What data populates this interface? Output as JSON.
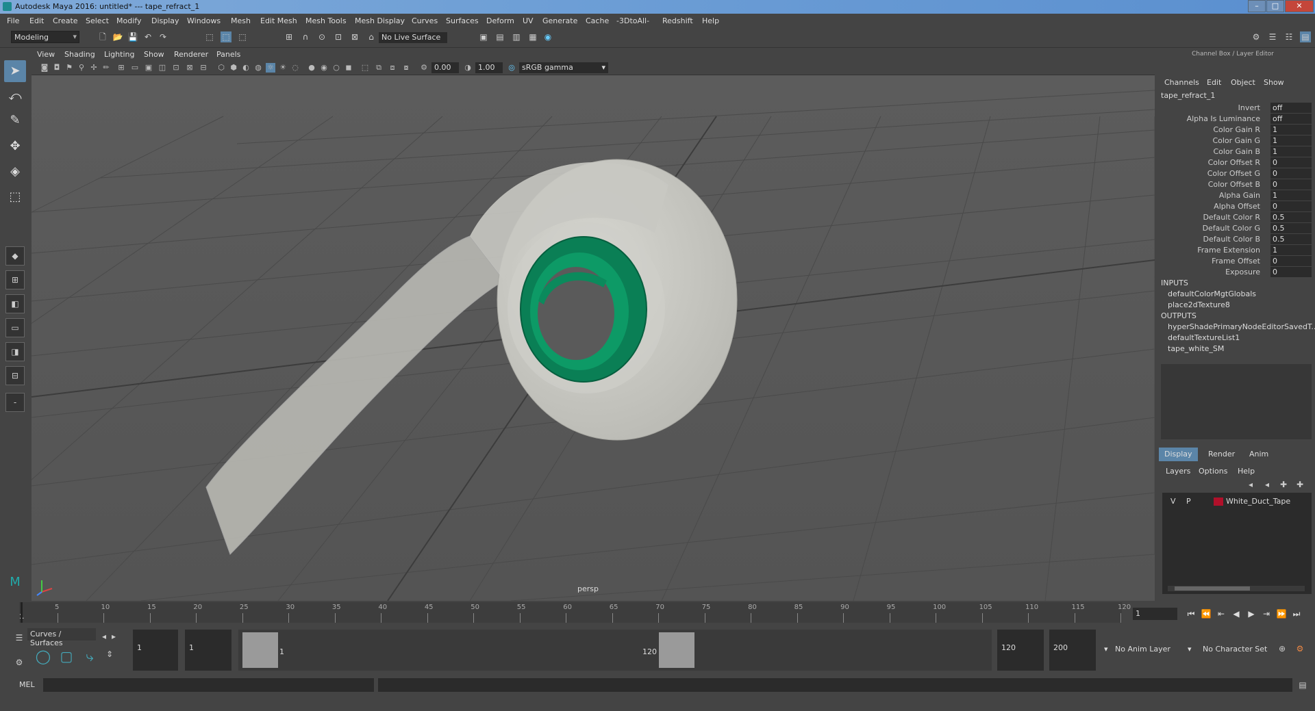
{
  "window": {
    "title": "Autodesk Maya 2016: untitled*   ---   tape_refract_1"
  },
  "menu": [
    "File",
    "Edit",
    "Create",
    "Select",
    "Modify",
    "Display",
    "Windows",
    "Mesh",
    "Edit Mesh",
    "Mesh Tools",
    "Mesh Display",
    "Curves",
    "Surfaces",
    "Deform",
    "UV",
    "Generate",
    "Cache",
    "-3DtoAll-",
    "Redshift",
    "Help"
  ],
  "shelf": {
    "mode": "Modeling",
    "live_surface": "No Live Surface"
  },
  "viewport": {
    "menu": [
      "View",
      "Shading",
      "Lighting",
      "Show",
      "Renderer",
      "Panels"
    ],
    "exposure": "0.00",
    "gamma": "1.00",
    "color_space": "sRGB gamma",
    "camera": "persp"
  },
  "channel_box": {
    "header": "Channel Box / Layer Editor",
    "tabs": [
      "Channels",
      "Edit",
      "Object",
      "Show"
    ],
    "node": "tape_refract_1",
    "attributes": [
      {
        "label": "Invert",
        "value": "off"
      },
      {
        "label": "Alpha Is Luminance",
        "value": "off"
      },
      {
        "label": "Color Gain R",
        "value": "1"
      },
      {
        "label": "Color Gain G",
        "value": "1"
      },
      {
        "label": "Color Gain B",
        "value": "1"
      },
      {
        "label": "Color Offset R",
        "value": "0"
      },
      {
        "label": "Color Offset G",
        "value": "0"
      },
      {
        "label": "Color Offset B",
        "value": "0"
      },
      {
        "label": "Alpha Gain",
        "value": "1"
      },
      {
        "label": "Alpha Offset",
        "value": "0"
      },
      {
        "label": "Default Color R",
        "value": "0.5"
      },
      {
        "label": "Default Color G",
        "value": "0.5"
      },
      {
        "label": "Default Color B",
        "value": "0.5"
      },
      {
        "label": "Frame Extension",
        "value": "1"
      },
      {
        "label": "Frame Offset",
        "value": "0"
      },
      {
        "label": "Exposure",
        "value": "0"
      }
    ],
    "inputs_label": "INPUTS",
    "inputs": [
      "defaultColorMgtGlobals",
      "place2dTexture8"
    ],
    "outputs_label": "OUTPUTS",
    "outputs": [
      "hyperShadePrimaryNodeEditorSavedT...",
      "defaultTextureList1",
      "tape_white_SM"
    ]
  },
  "layer_editor": {
    "tabs": [
      "Display",
      "Render",
      "Anim"
    ],
    "menu": [
      "Layers",
      "Options",
      "Help"
    ],
    "layers": [
      {
        "v": "V",
        "p": "P",
        "name": "White_Duct_Tape",
        "color": "#b0102a"
      }
    ]
  },
  "timeline": {
    "ticks": [
      "5",
      "10",
      "15",
      "20",
      "25",
      "30",
      "35",
      "40",
      "45",
      "50",
      "55",
      "60",
      "65",
      "70",
      "75",
      "80",
      "85",
      "90",
      "95",
      "100",
      "105",
      "110",
      "115",
      "120"
    ],
    "start_label": "1",
    "current_frame": "1"
  },
  "range": {
    "shelf_tab": "Curves / Surfaces",
    "start": "1",
    "start2": "1",
    "range_start": "1",
    "range_end": "120",
    "end": "120",
    "end2": "200",
    "anim_layer": "No Anim Layer",
    "character_set": "No Character Set"
  },
  "command": {
    "label": "MEL"
  }
}
